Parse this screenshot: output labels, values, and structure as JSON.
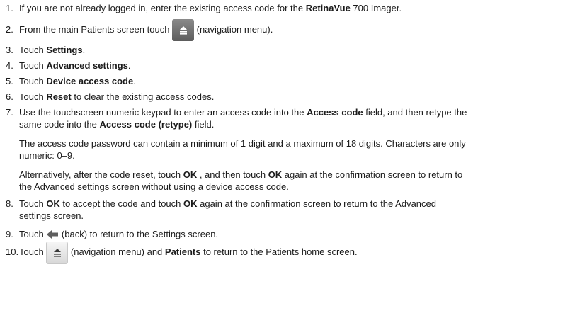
{
  "steps": [
    {
      "num": "1.",
      "pre": "If you are not already logged in, enter the existing access code for the ",
      "bold": "RetinaVue",
      "post": " 700 Imager."
    },
    {
      "num": "2.",
      "pre": "From the main Patients screen touch ",
      "post": " (navigation menu)."
    },
    {
      "num": "3.",
      "pre": "Touch ",
      "bold": "Settings",
      "post": "."
    },
    {
      "num": "4.",
      "pre": "Touch ",
      "bold": "Advanced settings",
      "post": "."
    },
    {
      "num": "5.",
      "pre": "Touch ",
      "bold": "Device access code",
      "post": "."
    },
    {
      "num": "6.",
      "pre": "Touch ",
      "bold": "Reset",
      "post": " to clear the existing access codes."
    },
    {
      "num": "7.",
      "line1_pre": "Use the touchscreen numeric keypad to enter an access code into the ",
      "line1_bold": "Access code",
      "line1_post": " field, and then retype the",
      "line2_pre": "same code into the ",
      "line2_bold": "Access code (retype)",
      "line2_post": " field.",
      "para1_line1": "The access code password can contain a minimum of 1 digit and a maximum of 18 digits. Characters are only",
      "para1_line2": "numeric: 0–9.",
      "para2_l1_pre": "Alternatively, after the code reset, touch ",
      "para2_l1_bold": "OK",
      "para2_l1_mid": " , and then touch ",
      "para2_l1_bold2": "OK",
      "para2_l1_post": " again at the confirmation screen to return to",
      "para2_line2": "the Advanced settings screen without using a device access code."
    },
    {
      "num": "8.",
      "pre": "Touch ",
      "bold": "OK",
      "mid": " to accept the code and touch ",
      "bold2": "OK",
      "post": " again at the confirmation screen to return to the Advanced",
      "line2": "settings screen."
    },
    {
      "num": "9.",
      "pre": "Touch ",
      "post": " (back) to return to the Settings screen."
    },
    {
      "num": "10.",
      "pre": "Touch ",
      "mid": " (navigation menu) and ",
      "bold": "Patients",
      "post": " to return to the Patients home screen."
    }
  ],
  "icons": {
    "step2": "navigation-menu-icon",
    "step9": "back-arrow-icon",
    "step10": "navigation-menu-icon"
  }
}
